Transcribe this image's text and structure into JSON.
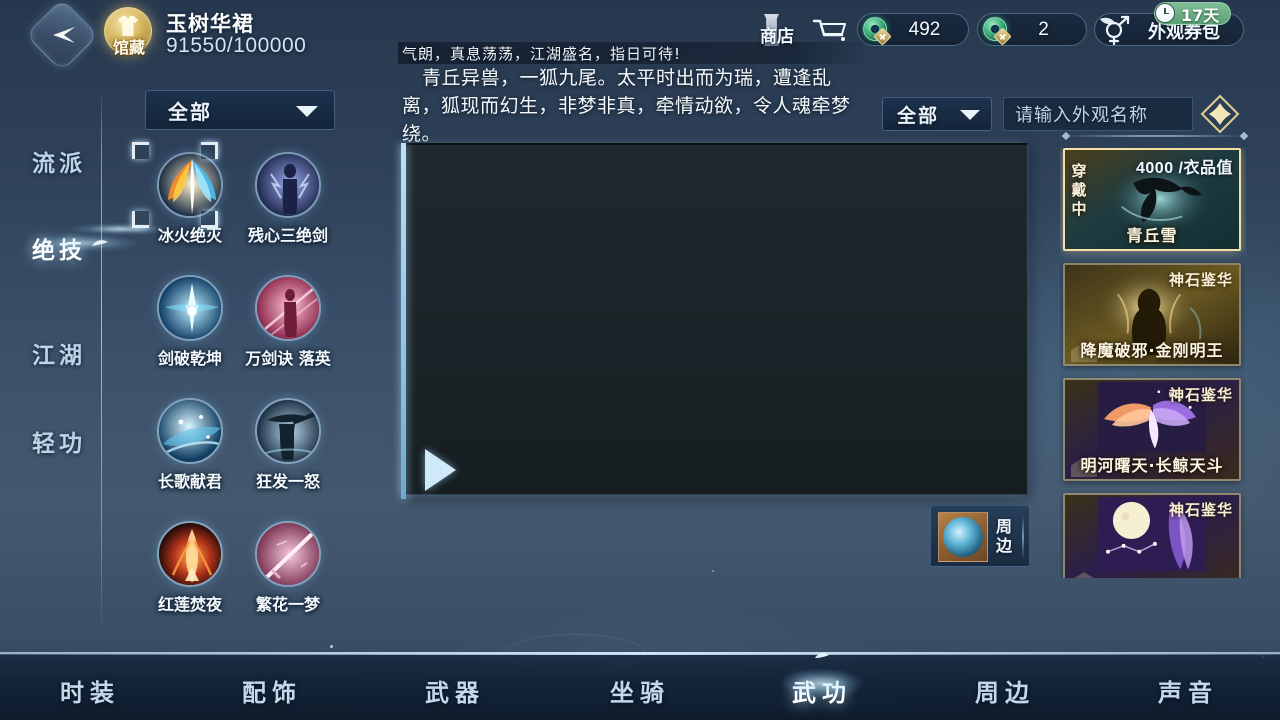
{
  "header": {
    "back_icon": "back-arrow-icon",
    "collection_badge": "馆藏",
    "player_name": "玉树华裙",
    "player_progress": "91550/100000",
    "shop_label": "商店",
    "cart_icon": "shopping-cart-icon",
    "currencies": [
      {
        "icon": "jade-coin-icon",
        "value": "492"
      },
      {
        "icon": "jade-coin-icon",
        "value": "2"
      }
    ],
    "pack": {
      "icon": "gender-pair-icon",
      "label": "外观券包",
      "days_badge": "17天",
      "clock_icon": "clock-icon"
    }
  },
  "sidebar": {
    "tabs": [
      {
        "label": "流派",
        "active": false
      },
      {
        "label": "绝技",
        "active": true
      },
      {
        "label": "江湖",
        "active": false
      },
      {
        "label": "轻功",
        "active": false
      }
    ]
  },
  "skill_panel": {
    "filter": {
      "label": "全部",
      "caret_icon": "chevron-down-icon"
    },
    "skills": [
      {
        "name": "冰火绝灭",
        "selected": true
      },
      {
        "name": "残心三绝剑",
        "selected": false
      },
      {
        "name": "剑破乾坤",
        "selected": false
      },
      {
        "name": "万剑诀 落英",
        "selected": false
      },
      {
        "name": "长歌献君",
        "selected": false
      },
      {
        "name": "狂发一怒",
        "selected": false
      },
      {
        "name": "红莲焚夜",
        "selected": false
      },
      {
        "name": "繁花一梦",
        "selected": false
      }
    ]
  },
  "detail": {
    "tagline": "气朗，真息荡荡，江湖盛名，指日可待!",
    "description": "青丘异兽，一狐九尾。太平时出而为瑞，遭逢乱离，狐现而幻生，非梦非真，牵情动欲，令人魂牵梦绕。",
    "play_icon": "play-triangle-icon",
    "peripheral": {
      "label": "周边",
      "thumb_icon": "peripheral-thumb-icon"
    }
  },
  "right_panel": {
    "filter": {
      "label": "全部",
      "caret_icon": "chevron-down-icon"
    },
    "search": {
      "placeholder": "请输入外观名称",
      "icon": "diamond-search-icon"
    },
    "items": [
      {
        "name": "青丘雪",
        "price": "4000 /衣品值",
        "status": "穿戴中",
        "selected": true
      },
      {
        "name": "降魔破邪·金刚明王",
        "tag": "神石鉴华",
        "selected": false
      },
      {
        "name": "明河曙天·长鲸天斗",
        "tag": "神石鉴华",
        "selected": false
      },
      {
        "name": "",
        "tag": "神石鉴华",
        "selected": false
      }
    ]
  },
  "bottom_nav": {
    "items": [
      {
        "label": "时装",
        "active": false
      },
      {
        "label": "配饰",
        "active": false
      },
      {
        "label": "武器",
        "active": false
      },
      {
        "label": "坐骑",
        "active": false
      },
      {
        "label": "武功",
        "active": true
      },
      {
        "label": "周边",
        "active": false
      },
      {
        "label": "声音",
        "active": false
      }
    ]
  },
  "colors": {
    "accent_blue": "#b9e2f8",
    "gold": "#d8b862",
    "jade_green": "#3fae7d",
    "panel_dark": "#16213a"
  }
}
